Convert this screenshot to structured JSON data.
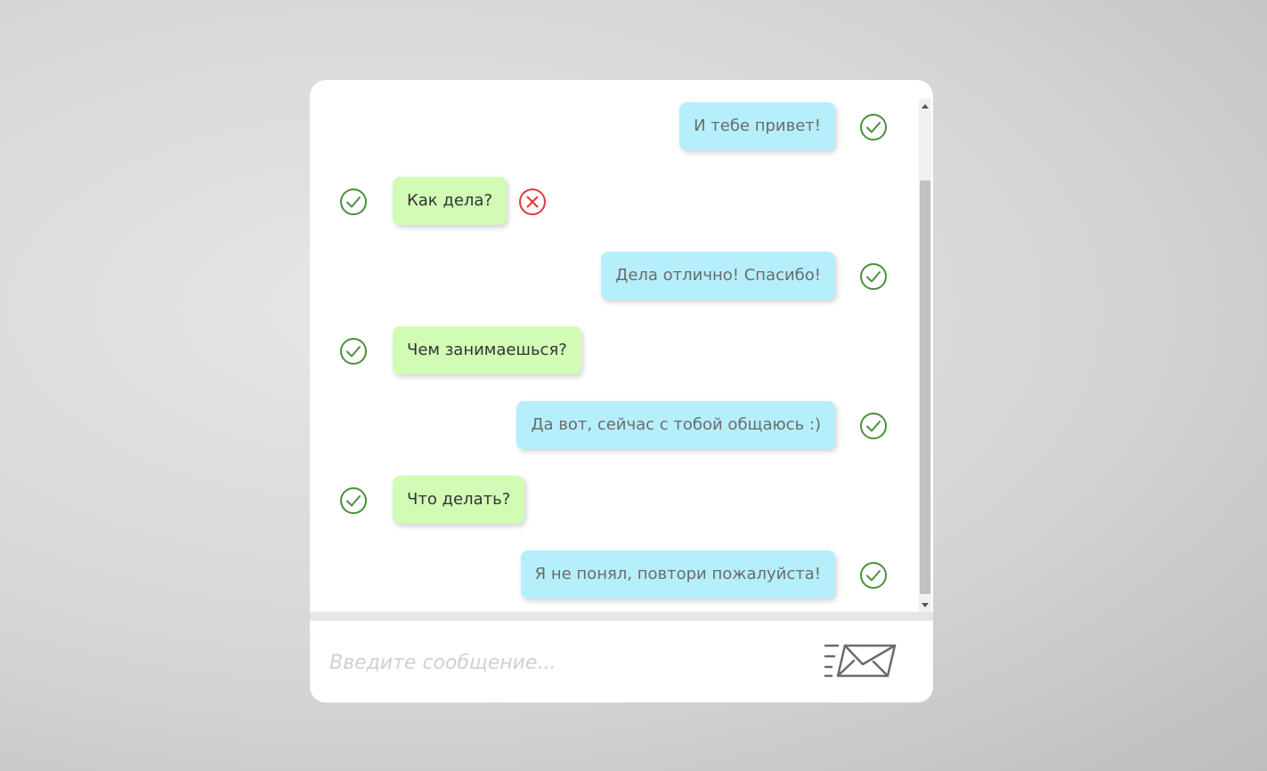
{
  "chat": {
    "messages": [
      {
        "side": "outgoing",
        "text": "И тебе привет!",
        "status": "delivered"
      },
      {
        "side": "incoming",
        "text": "Как дела?",
        "status": "delivered",
        "error": true
      },
      {
        "side": "outgoing",
        "text": "Дела отлично! Спасибо!",
        "status": "delivered"
      },
      {
        "side": "incoming",
        "text": "Чем занимаешься?",
        "status": "delivered"
      },
      {
        "side": "outgoing",
        "text": "Да вот, сейчас с тобой общаюсь :)",
        "status": "delivered"
      },
      {
        "side": "incoming",
        "text": "Что делать?",
        "status": "delivered"
      },
      {
        "side": "outgoing",
        "text": "Я не понял, повтори пожалуйста!",
        "status": "delivered"
      }
    ]
  },
  "input": {
    "placeholder": "Введите сообщение...",
    "value": ""
  },
  "icons": {
    "status": "check-circle-icon",
    "error": "close-circle-icon",
    "send": "send-envelope-icon"
  },
  "colors": {
    "outgoing_bubble": "#b6effc",
    "incoming_bubble": "#d2fcb6",
    "check": "#4a8f3c",
    "error": "#e0383e"
  }
}
